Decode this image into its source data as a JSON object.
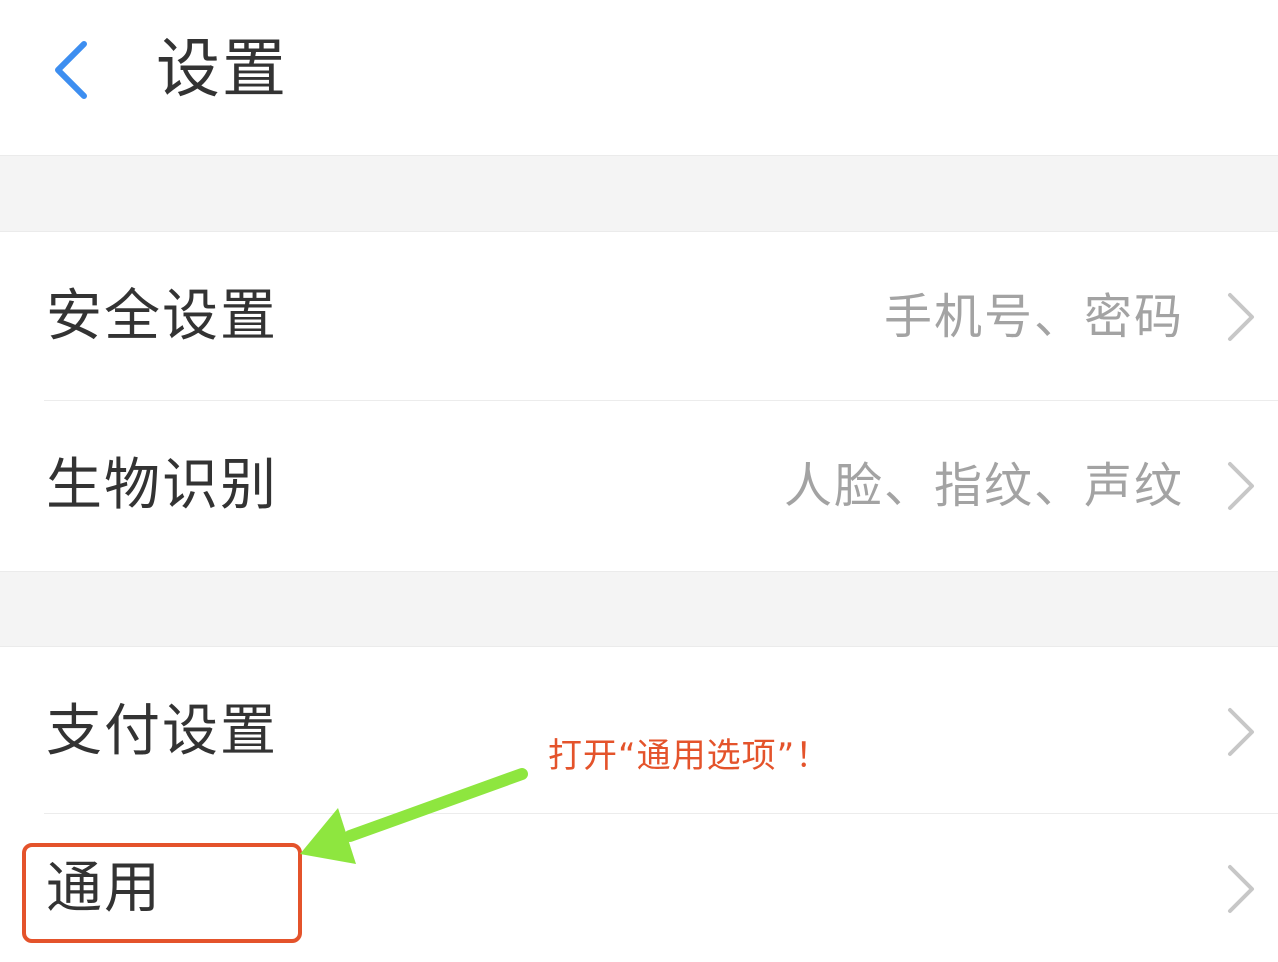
{
  "header": {
    "back_icon": "chevron-left-icon",
    "title": "设置",
    "accent_color": "#3d8ef0"
  },
  "settings": {
    "security": {
      "label": "安全设置",
      "value": "手机号、密码"
    },
    "biometric": {
      "label": "生物识别",
      "value": "人脸、指纹、声纹"
    },
    "payment": {
      "label": "支付设置",
      "value": ""
    },
    "general": {
      "label": "通用",
      "value": ""
    }
  },
  "annotation": {
    "text": "打开“通用选项”！",
    "text_color": "#e4532b",
    "arrow_color": "#8ee63f",
    "box_color": "#e4532b"
  }
}
